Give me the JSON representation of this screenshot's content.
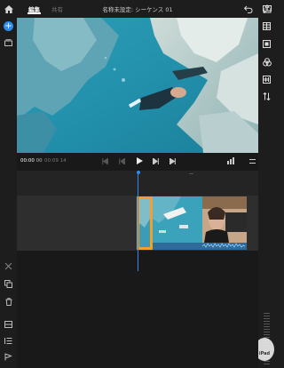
{
  "header": {
    "tabs": [
      {
        "label": "編集"
      },
      {
        "label": "共有"
      }
    ],
    "title": "名称未設定: シーケンス 01"
  },
  "transport": {
    "current_time": "00:00",
    "current_frames": "00",
    "duration": "00:09 14"
  },
  "icons": {
    "left": [
      "home-icon",
      "add-icon",
      "media-panel-icon",
      "split-icon",
      "duplicate-icon",
      "trash-icon",
      "caption-icon",
      "list-icon",
      "flag-icon"
    ],
    "right": [
      "comment-icon",
      "crop-icon",
      "color-icon",
      "adjust-icon",
      "transition-icon",
      "speed-icon"
    ]
  },
  "colors": {
    "accent": "#2d8ceb",
    "selection": "#f0a030",
    "background": "#1d1d1d"
  },
  "watermark": "iPad"
}
